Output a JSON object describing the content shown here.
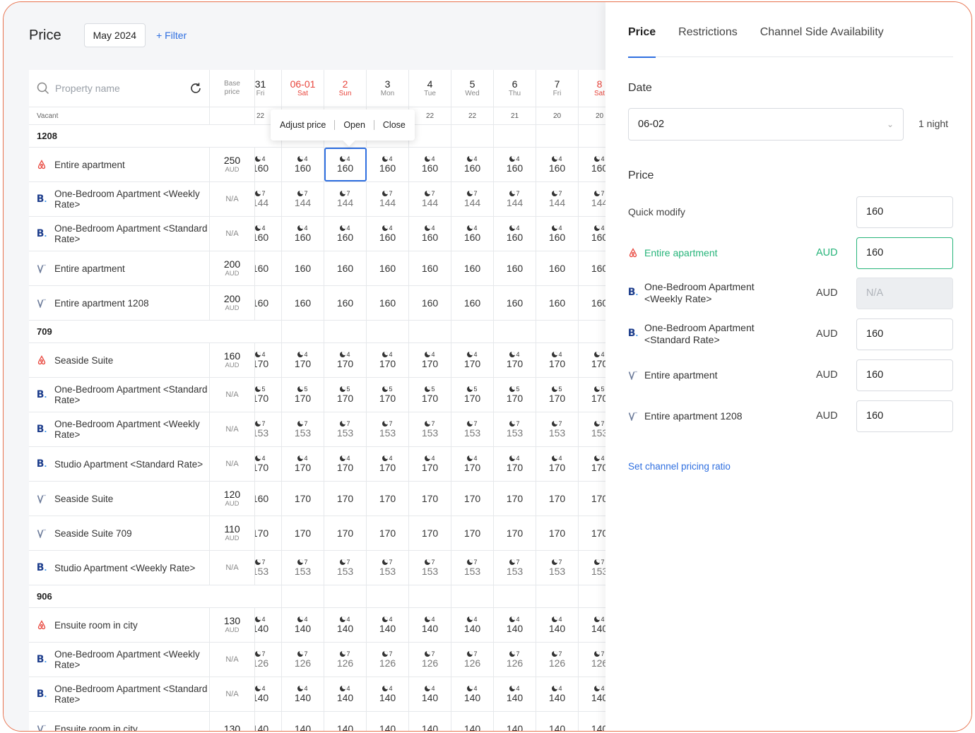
{
  "header": {
    "title": "Price",
    "month": "May 2024",
    "filter": "+ Filter"
  },
  "table": {
    "search_placeholder": "Property name",
    "base_price_header": "Base price",
    "vacant_label": "Vacant",
    "dates": [
      {
        "num": "31",
        "wd": "Fri",
        "vacant": "22",
        "red": false
      },
      {
        "num": "06-01",
        "wd": "Sat",
        "vacant": "",
        "red": true
      },
      {
        "num": "2",
        "wd": "Sun",
        "vacant": "",
        "red": true
      },
      {
        "num": "3",
        "wd": "Mon",
        "vacant": "",
        "red": false
      },
      {
        "num": "4",
        "wd": "Tue",
        "vacant": "22",
        "red": false
      },
      {
        "num": "5",
        "wd": "Wed",
        "vacant": "22",
        "red": false
      },
      {
        "num": "6",
        "wd": "Thu",
        "vacant": "21",
        "red": false
      },
      {
        "num": "7",
        "wd": "Fri",
        "vacant": "20",
        "red": false
      },
      {
        "num": "8",
        "wd": "Sat",
        "vacant": "20",
        "red": true
      }
    ],
    "rows": [
      {
        "type": "group",
        "label": "1208"
      },
      {
        "type": "item",
        "channel": "airbnb",
        "name": "Entire apartment",
        "base": "250",
        "unit": "AUD",
        "price": "160",
        "minstay": "4",
        "selected": 2
      },
      {
        "type": "item",
        "channel": "booking",
        "name": "One-Bedroom Apartment <Weekly Rate>",
        "base": "N/A",
        "unit": "",
        "price": "144",
        "minstay": "7",
        "muted": true
      },
      {
        "type": "item",
        "channel": "booking",
        "name": "One-Bedroom Apartment <Standard Rate>",
        "base": "N/A",
        "unit": "",
        "price": "160",
        "minstay": "4"
      },
      {
        "type": "item",
        "channel": "vrbo",
        "name": "Entire apartment",
        "base": "200",
        "unit": "AUD",
        "price": "160",
        "minstay": ""
      },
      {
        "type": "item",
        "channel": "vrbo",
        "name": "Entire apartment 1208",
        "base": "200",
        "unit": "AUD",
        "price": "160",
        "minstay": ""
      },
      {
        "type": "group",
        "label": "709"
      },
      {
        "type": "item",
        "channel": "airbnb",
        "name": "Seaside Suite",
        "base": "160",
        "unit": "AUD",
        "price": "170",
        "minstay": "4"
      },
      {
        "type": "item",
        "channel": "booking",
        "name": "One-Bedroom Apartment <Standard Rate>",
        "base": "N/A",
        "unit": "",
        "price": "170",
        "minstay": "5"
      },
      {
        "type": "item",
        "channel": "booking",
        "name": "One-Bedroom Apartment <Weekly Rate>",
        "base": "N/A",
        "unit": "",
        "price": "153",
        "minstay": "7",
        "muted": true
      },
      {
        "type": "item",
        "channel": "booking",
        "name": "Studio Apartment <Standard Rate>",
        "base": "N/A",
        "unit": "",
        "price": "170",
        "minstay": "4"
      },
      {
        "type": "item",
        "channel": "vrbo",
        "name": "Seaside Suite",
        "base": "120",
        "unit": "AUD",
        "price": "170",
        "minstay": "",
        "first": "160"
      },
      {
        "type": "item",
        "channel": "vrbo",
        "name": "Seaside Suite 709",
        "base": "110",
        "unit": "AUD",
        "price": "170",
        "minstay": ""
      },
      {
        "type": "item",
        "channel": "booking",
        "name": "Studio Apartment <Weekly Rate>",
        "base": "N/A",
        "unit": "",
        "price": "153",
        "minstay": "7",
        "muted": true
      },
      {
        "type": "group",
        "label": "906"
      },
      {
        "type": "item",
        "channel": "airbnb",
        "name": "Ensuite room in city",
        "base": "130",
        "unit": "AUD",
        "price": "140",
        "minstay": "4"
      },
      {
        "type": "item",
        "channel": "booking",
        "name": "One-Bedroom Apartment <Weekly Rate>",
        "base": "N/A",
        "unit": "",
        "price": "126",
        "minstay": "7",
        "muted": true
      },
      {
        "type": "item",
        "channel": "booking",
        "name": "One-Bedroom Apartment <Standard Rate>",
        "base": "N/A",
        "unit": "",
        "price": "140",
        "minstay": "4"
      },
      {
        "type": "item",
        "channel": "vrbo",
        "name": "Ensuite room in city",
        "base": "130",
        "unit": "",
        "price": "140",
        "minstay": ""
      }
    ]
  },
  "popup": {
    "adjust": "Adjust price",
    "open": "Open",
    "close": "Close"
  },
  "panel": {
    "tabs": [
      "Price",
      "Restrictions",
      "Channel Side Availability"
    ],
    "date_title": "Date",
    "date_value": "06-02",
    "nights": "1 night",
    "price_title": "Price",
    "quick_modify_label": "Quick modify",
    "quick_modify_value": "160",
    "channels": [
      {
        "channel": "airbnb",
        "name": "Entire apartment",
        "currency": "AUD",
        "value": "160",
        "active": true,
        "disabled": false
      },
      {
        "channel": "booking",
        "name": "One-Bedroom Apartment <Weekly Rate>",
        "currency": "AUD",
        "value": "N/A",
        "active": false,
        "disabled": true
      },
      {
        "channel": "booking",
        "name": "One-Bedroom Apartment <Standard Rate>",
        "currency": "AUD",
        "value": "160",
        "active": false,
        "disabled": false
      },
      {
        "channel": "vrbo",
        "name": "Entire apartment",
        "currency": "AUD",
        "value": "160",
        "active": false,
        "disabled": false
      },
      {
        "channel": "vrbo",
        "name": "Entire apartment 1208",
        "currency": "AUD",
        "value": "160",
        "active": false,
        "disabled": false
      }
    ],
    "ratio_link": "Set channel pricing ratio"
  }
}
